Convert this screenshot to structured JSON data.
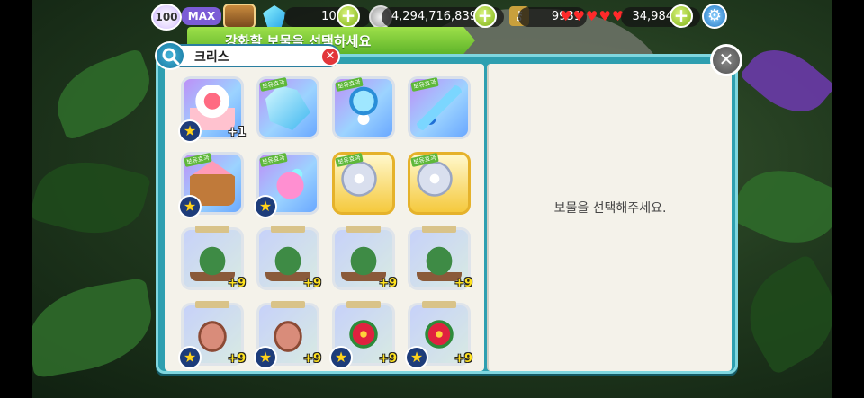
{
  "hud": {
    "level": "100",
    "level_tag": "MAX",
    "gems": "109",
    "coins": "4,294,716,839",
    "keys": "9931",
    "hearts": "34,984",
    "plus": "+",
    "gear": "⚙"
  },
  "dialog": {
    "title": "강화할 보물을 선택하세요",
    "close": "✕"
  },
  "search": {
    "query": "크리스",
    "clear": "✕"
  },
  "detail": {
    "empty_message": "보물을 선택해주세요."
  },
  "tiles": [
    {
      "art": "cake",
      "style": "purple",
      "tag": "",
      "star": true,
      "plus": "+1"
    },
    {
      "art": "crystal",
      "style": "purple",
      "tag": "보유효과",
      "star": false,
      "plus": ""
    },
    {
      "art": "gem-amulet",
      "style": "purple",
      "tag": "보유효과",
      "star": false,
      "plus": ""
    },
    {
      "art": "sword",
      "style": "purple",
      "tag": "보유효과",
      "star": false,
      "plus": ""
    },
    {
      "art": "gingerbread-house",
      "style": "purple",
      "tag": "보유효과",
      "star": true,
      "plus": ""
    },
    {
      "art": "unicorn",
      "style": "purple",
      "tag": "보유효과",
      "star": true,
      "plus": ""
    },
    {
      "art": "ornament",
      "style": "gold",
      "tag": "보유효과",
      "star": false,
      "plus": ""
    },
    {
      "art": "ornament",
      "style": "gold",
      "tag": "보유효과",
      "star": false,
      "plus": ""
    },
    {
      "art": "christmas-tree",
      "style": "faded",
      "tag": "",
      "star": false,
      "plus": "+9"
    },
    {
      "art": "christmas-tree",
      "style": "faded",
      "tag": "",
      "star": false,
      "plus": "+9"
    },
    {
      "art": "christmas-tree",
      "style": "faded",
      "tag": "",
      "star": false,
      "plus": "+9"
    },
    {
      "art": "christmas-tree",
      "style": "faded",
      "tag": "",
      "star": false,
      "plus": "+9"
    },
    {
      "art": "ham",
      "style": "faded",
      "tag": "",
      "star": true,
      "plus": "+9"
    },
    {
      "art": "ham",
      "style": "faded",
      "tag": "",
      "star": true,
      "plus": "+9"
    },
    {
      "art": "flower",
      "style": "faded",
      "tag": "",
      "star": true,
      "plus": "+9"
    },
    {
      "art": "flower",
      "style": "faded",
      "tag": "",
      "star": true,
      "plus": "+9"
    }
  ],
  "colors": {
    "panel": "#2e9fb0",
    "ribbon": "#7cc93a",
    "close_red": "#e2363a"
  }
}
